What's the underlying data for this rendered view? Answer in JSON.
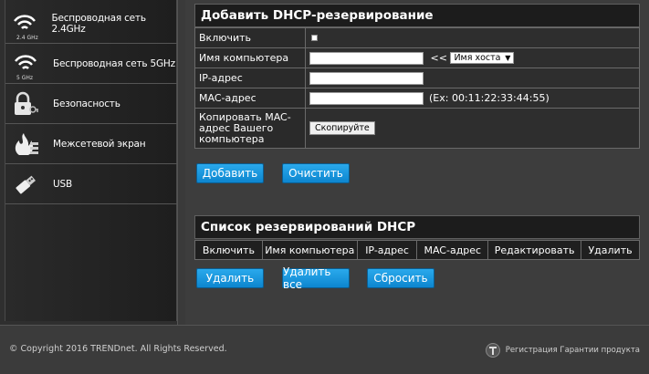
{
  "sidebar": {
    "items": [
      {
        "label": "Беспроводная сеть 2.4GHz",
        "icon": "wifi-icon",
        "sub": "2.4 GHz"
      },
      {
        "label": "Беспроводная сеть 5GHz",
        "icon": "wifi-icon",
        "sub": "5 GHz"
      },
      {
        "label": "Безопасность",
        "icon": "lock-key-icon"
      },
      {
        "label": "Межсетевой экран",
        "icon": "firewall-icon"
      },
      {
        "label": "USB",
        "icon": "usb-icon"
      }
    ]
  },
  "dhcp_add": {
    "title": "Добавить DHCP-резервирование",
    "enable_label": "Включить",
    "computer_name_label": "Имя компьютера",
    "arrow_label": "<<",
    "hostname_select": "Имя хоста",
    "ip_label": "IP-адрес",
    "mac_label": "MAC-адрес",
    "mac_hint": "(Ex: 00:11:22:33:44:55)",
    "copy_mac_label": "Копировать MAC-адрес Вашего компьютера",
    "copy_button": "Скопируйте",
    "add_button": "Добавить",
    "clear_button": "Очистить"
  },
  "dhcp_list": {
    "title": "Список резервирований DHCP",
    "columns": [
      "Включить",
      "Имя компьютера",
      "IP-адрес",
      "MAC-адрес",
      "Редактировать",
      "Удалить"
    ],
    "delete_button": "Удалить",
    "delete_all_button": "Удалить все",
    "reset_button": "Сбросить"
  },
  "footer": {
    "copyright": "© Copyright 2016 TRENDnet. All Rights Reserved.",
    "warranty": "Регистрация Гарантии продукта"
  },
  "colors": {
    "accent": "#1a97de",
    "header_bg": "#1c1c1c"
  }
}
